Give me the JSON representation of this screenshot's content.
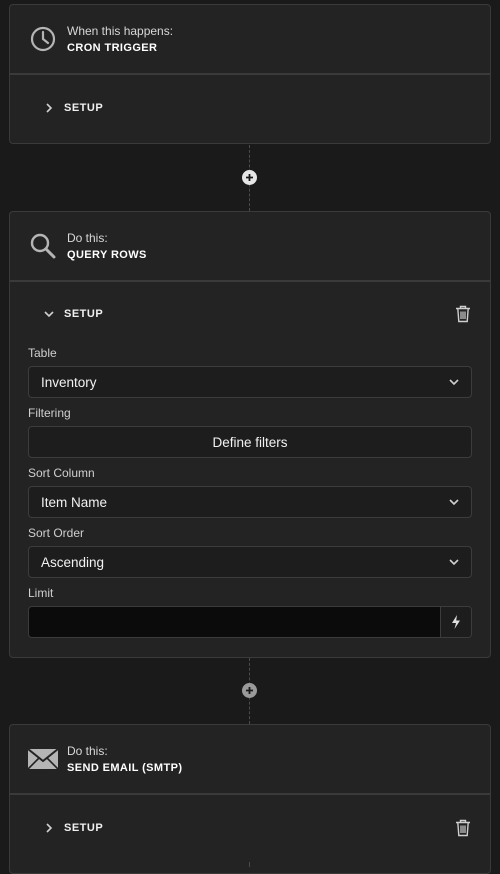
{
  "steps": [
    {
      "label": "When this happens:",
      "title": "CRON TRIGGER",
      "icon": "clock-icon",
      "setup_label": "SETUP"
    },
    {
      "label": "Do this:",
      "title": "QUERY ROWS",
      "icon": "search-icon",
      "setup_label": "SETUP",
      "fields": {
        "table": {
          "label": "Table",
          "value": "Inventory"
        },
        "filtering": {
          "label": "Filtering",
          "button": "Define filters"
        },
        "sort_column": {
          "label": "Sort Column",
          "value": "Item Name"
        },
        "sort_order": {
          "label": "Sort Order",
          "value": "Ascending"
        },
        "limit": {
          "label": "Limit",
          "value": ""
        }
      }
    },
    {
      "label": "Do this:",
      "title": "SEND EMAIL (SMTP)",
      "icon": "envelope-icon",
      "setup_label": "SETUP"
    }
  ],
  "colors": {
    "background": "#1a1a1a",
    "card": "#232323",
    "border": "#3a3a3a",
    "add_step_active": "#e6e6e6",
    "add_step_muted": "#9a9a9a"
  }
}
